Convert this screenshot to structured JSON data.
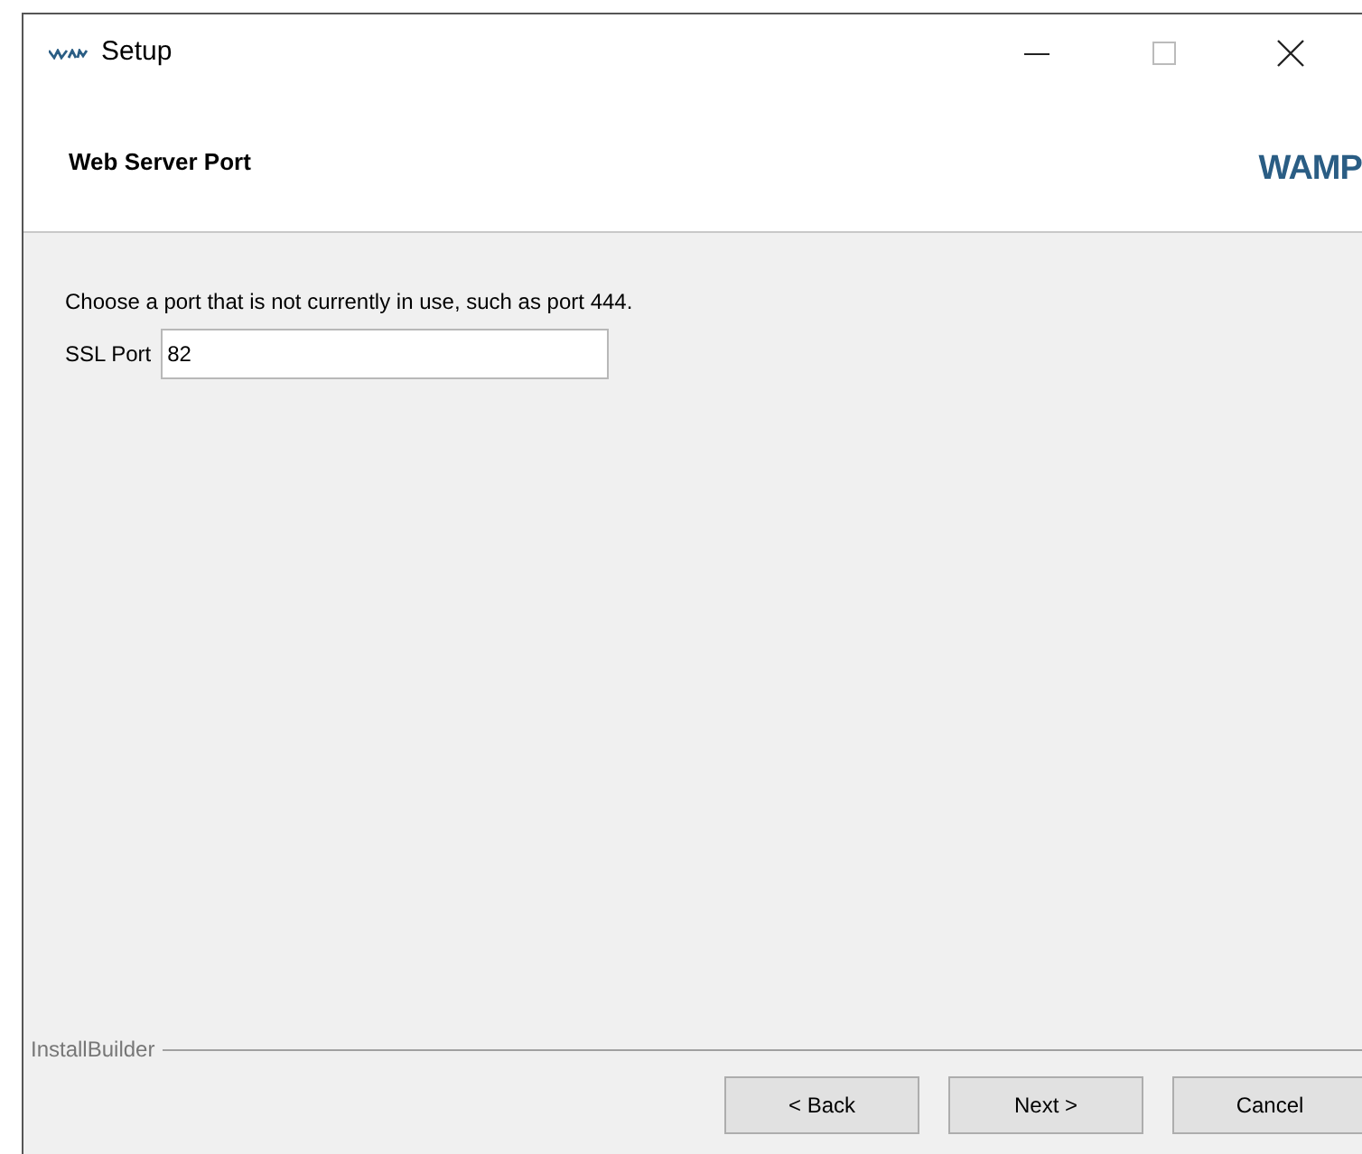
{
  "window": {
    "title": "Setup"
  },
  "header": {
    "title": "Web Server Port",
    "logo_text": "WAMP"
  },
  "body": {
    "instruction": "Choose a port that is not currently in use, such as port 444.",
    "field": {
      "label": "SSL Port",
      "value": "82"
    }
  },
  "footer": {
    "brand": "InstallBuilder",
    "buttons": [
      "< Back",
      "Next >",
      "Cancel"
    ]
  }
}
